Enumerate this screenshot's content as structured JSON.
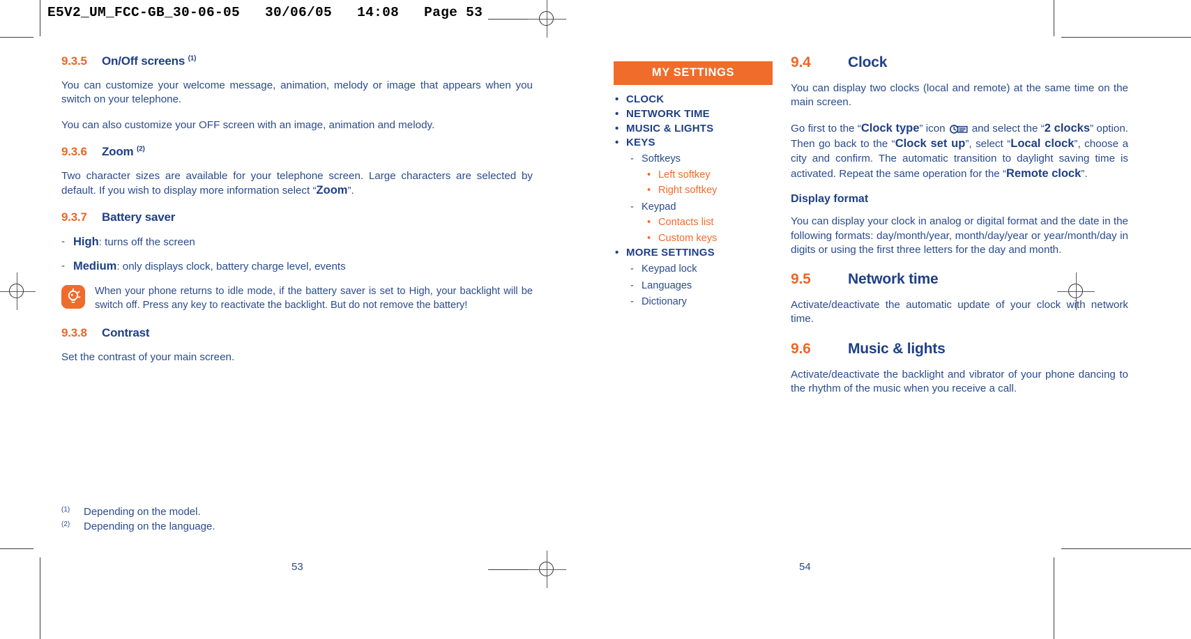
{
  "print_header": "E5V2_UM_FCC-GB_30-06-05   30/06/05   14:08   Page 53",
  "colors": {
    "orange": "#ef6c2a",
    "blue": "#1f3f87",
    "body_blue": "#2a4b8d"
  },
  "left_page": {
    "page_number": "53",
    "sections": [
      {
        "number": "9.3.5",
        "title": "On/Off screens",
        "superscript": "(1)"
      },
      {
        "number": "9.3.6",
        "title": "Zoom",
        "superscript": "(2)"
      },
      {
        "number": "9.3.7",
        "title": "Battery saver",
        "superscript": ""
      },
      {
        "number": "9.3.8",
        "title": "Contrast",
        "superscript": ""
      }
    ],
    "para_onoff_1_a": "You can customize your welcome message, animation, melody or image that appears when you switch on",
    "para_onoff_1_b": "your telephone.",
    "para_onoff_2": "You can also customize your OFF screen with an image, animation and melody.",
    "para_zoom_a": "Two character sizes are available for your telephone screen. Large characters are selected by default. If you",
    "para_zoom_b_pre": "wish to display more information select “",
    "para_zoom_b_bold": "Zoom",
    "para_zoom_b_post": "”.",
    "battery_items": [
      {
        "dash": "-",
        "bold": "High",
        "rest": ": turns off the screen"
      },
      {
        "dash": "-",
        "bold": "Medium",
        "rest": ": only displays clock, battery charge level, events"
      }
    ],
    "tip": {
      "icon": "lightbulb-icon",
      "line1": "When your phone returns to idle mode, if the battery saver is set to High, your backlight will be",
      "line2": "switch off. Press any key to reactivate the backlight. But do not remove the battery!"
    },
    "para_contrast": "Set the contrast of your main screen.",
    "footnotes": [
      {
        "mark": "(1)",
        "text": "Depending on the model."
      },
      {
        "mark": "(2)",
        "text": "Depending on the language."
      }
    ]
  },
  "menu": {
    "banner": "MY SETTINGS",
    "items": [
      {
        "label": "CLOCK",
        "children": []
      },
      {
        "label": "NETWORK TIME",
        "children": []
      },
      {
        "label": "MUSIC & LIGHTS",
        "children": []
      },
      {
        "label": "KEYS",
        "children": [
          {
            "label": "Softkeys",
            "children": [
              {
                "label": "Left softkey"
              },
              {
                "label": "Right softkey"
              }
            ]
          },
          {
            "label": "Keypad",
            "children": [
              {
                "label": "Contacts list"
              },
              {
                "label": "Custom keys"
              }
            ]
          }
        ]
      },
      {
        "label": "MORE SETTINGS",
        "children": [
          {
            "label": "Keypad lock",
            "children": []
          },
          {
            "label": "Languages",
            "children": []
          },
          {
            "label": "Dictionary",
            "children": []
          }
        ]
      }
    ]
  },
  "right_page": {
    "page_number": "54",
    "sections": [
      {
        "number": "9.4",
        "title": "Clock"
      },
      {
        "number": "9.5",
        "title": "Network time"
      },
      {
        "number": "9.6",
        "title": "Music & lights"
      }
    ],
    "para_clock_1": "You can display two clocks (local and remote) at the same time on the main screen.",
    "clock_setup": {
      "t1": "Go first to the “",
      "b1": "Clock type",
      "t2": "” icon",
      "icon": "clock-type-icon",
      "t3": "and select the “",
      "b2": "2 clocks",
      "t4": "” option. Then go back to the “",
      "b3": "Clock set up",
      "t5": "”, select “",
      "b4": "Local clock",
      "t6": "”, choose a city and confirm. The automatic transition to daylight saving time is activated. Repeat the same operation for the “",
      "b5": "Remote clock",
      "t7": "”."
    },
    "display_format_heading": "Display format",
    "para_display_format": "You can display your clock in analog or digital format and the date in the following formats: day/month/year, month/day/year or year/month/day in digits or using the first three letters for the day and month.",
    "para_network_time": "Activate/deactivate the automatic update of your clock with network time.",
    "para_music_lights": "Activate/deactivate the backlight and vibrator of your phone dancing to the rhythm of the music when you receive a call."
  }
}
